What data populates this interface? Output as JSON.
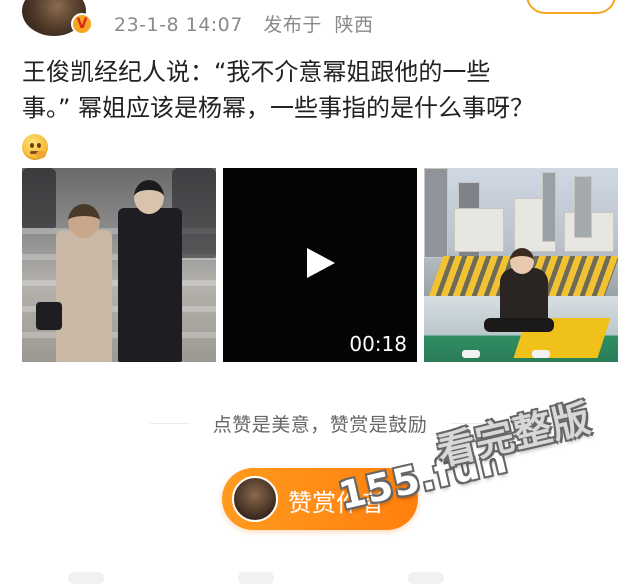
{
  "post": {
    "date": "23-1-8 14:07",
    "location_prefix": "发布于",
    "location": "陕西",
    "text_line1": "王俊凯经纪人说：“我不介意幂姐跟他的一些",
    "text_line2": "事。” 幂姐应该是杨幂，一些事指的是什么事呀？",
    "emoji": "thinking-emoji"
  },
  "media": {
    "video_duration": "00:18"
  },
  "reward": {
    "divider_text": "点赞是美意，赞赏是鼓励",
    "button_label": "赞赏作者"
  },
  "watermark": {
    "site": "155.fun",
    "slogan": "看完整版"
  },
  "colors": {
    "accent_orange": "#ff8c1a",
    "meta_gray": "#8a8a8a",
    "verified_badge": "#f6a623"
  }
}
